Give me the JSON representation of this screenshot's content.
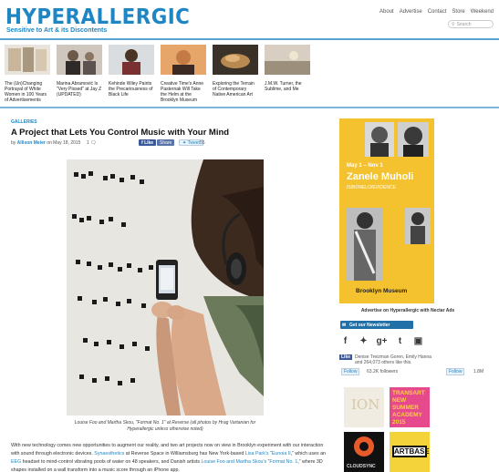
{
  "header": {
    "logo": "HYPERALLERGIC",
    "tagline": "Sensitive to Art & its Discontents",
    "nav": [
      "About",
      "Advertise",
      "Contact",
      "Store",
      "Weekend"
    ],
    "search_placeholder": "Search"
  },
  "featured": [
    {
      "caption": "The (Un)Changing Portrayal of White Women in 100 Years of Advertisements"
    },
    {
      "caption": "Marina Abramović Is \"Very Pissed\" at Jay Z (UPDATED)"
    },
    {
      "caption": "Kehinde Wiley Paints the Precariousness of Black Life"
    },
    {
      "caption": "Creative Time's Anne Pasternak Will Take the Helm at the Brooklyn Museum"
    },
    {
      "caption": "Exploring the Terrain of Contemporary Native American Art"
    },
    {
      "caption": "J.M.W. Turner, the Sublime, and Me"
    }
  ],
  "article": {
    "category": "GALLERIES",
    "title": "A Project that Lets You Control Music with Your Mind",
    "byline_prefix": "by",
    "author": "Allison Meier",
    "date": "on May 18, 2015",
    "comments": "1",
    "like_label": "Like",
    "share_label": "Share",
    "tweet_label": "Tweet",
    "tweet_count": "55",
    "caption": "Louise Foo and Martha Skou, \"Format No. 1\" at Reverse (all photos by Hrag Vartanian for Hyperallergic unless otherwise noted)",
    "body": {
      "p1": "With new technology comes new opportunities to augment our reality, and two art projects now on view in Brooklyn experiment with our interaction with sound through electronic devices.",
      "l1": "Synaesthetics",
      "p2": " at Reverse Space in Williamsburg has New York-based ",
      "l2": "Lisa Park's",
      "p3": " “",
      "l3": "Eunoia II",
      "p4": ",” which uses an ",
      "l4": "EEG",
      "p5": " headset to mind-control vibrating pools of water on 48 speakers, and Danish artists ",
      "l5": "Louise Foo and Martha Skou's",
      "p6": " “",
      "l6": "Format No. 1",
      "p7": ",” where 3D shapes installed on a wall transform into a music score through an iPhone app."
    }
  },
  "sidebar": {
    "ad": {
      "dates": "May 1 – Nov 1",
      "artist": "Zanele Muholi",
      "subtitle": "ISIBONELO/EVIDENCE",
      "museum": "Brooklyn Museum"
    },
    "ad_caption": "Advertise on Hyperallergic with Nectar Ads",
    "newsletter": "Get our Newsletter",
    "facebook": {
      "like": "Like",
      "text": "Denise Treizman Goren, Emily Hanna and 264,073 others like this."
    },
    "twitter": {
      "follow": "Follow",
      "count": "63.2K followers",
      "follow2": "Follow",
      "count2": "1.8M"
    },
    "small_ads": [
      "ION",
      "TRANSART NEW SUMMER ACADEMY 2015",
      "CLOUDSYNC",
      "ARTBASE"
    ]
  },
  "colors": {
    "brand": "#1f86c4",
    "ad_yellow": "#f4c22f",
    "fb": "#3b5998"
  }
}
